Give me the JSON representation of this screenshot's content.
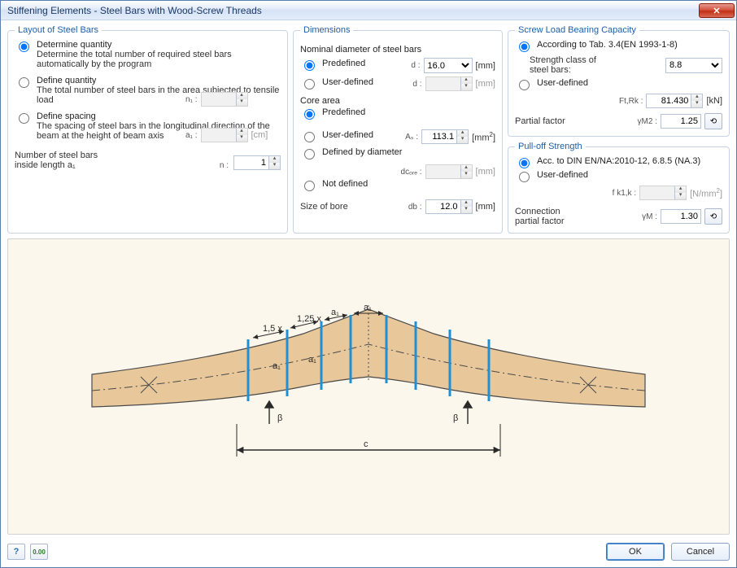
{
  "window": {
    "title": "Stiffening Elements - Steel Bars with Wood-Screw Threads"
  },
  "layout": {
    "legend": "Layout of Steel Bars",
    "opt_determine_title": "Determine quantity",
    "opt_determine_desc": "Determine the total number of required steel bars automatically by the program",
    "opt_define_qty_title": "Define quantity",
    "opt_define_qty_desc": "The total number of steel bars in the area subjected to tensile load",
    "n1_sym": "n₁ :",
    "n1_value": "",
    "opt_define_spacing_title": "Define spacing",
    "opt_define_spacing_desc": "The spacing of steel bars in the longitudinal direction of the beam at the height of beam axis",
    "a1_sym": "a₁ :",
    "a1_value": "",
    "a1_unit": "[cm]",
    "num_bars_label_l1": "Number of steel bars",
    "num_bars_label_l2": "inside length a₁",
    "n_sym": "n :",
    "n_value": "1"
  },
  "dimensions": {
    "legend": "Dimensions",
    "nominal_label": "Nominal diameter of steel bars",
    "predef": "Predefined",
    "userdef": "User-defined",
    "d_sym": "d :",
    "d_value": "16.0",
    "d_unit": "[mm]",
    "d_user_value": "",
    "core_label": "Core area",
    "As_sym": "Aₛ :",
    "As_value": "113.1",
    "As_unit": "[mm",
    "def_by_diam": "Defined by diameter",
    "dcore_sym": "dcₒᵣₑ :",
    "dcore_value": "",
    "dcore_unit": "[mm]",
    "not_defined": "Not defined",
    "size_bore_label": "Size of bore",
    "db_sym": "db :",
    "db_value": "12.0",
    "db_unit": "[mm]"
  },
  "screw": {
    "legend": "Screw Load Bearing Capacity",
    "opt_tab": "According to Tab. 3.4(EN 1993-1-8)",
    "strength_label_l1": "Strength class of",
    "strength_label_l2": "steel bars:",
    "strength_value": "8.8",
    "opt_user": "User-defined",
    "FtRk_sym": "Ft,Rk :",
    "FtRk_value": "81.430",
    "FtRk_unit": "[kN]",
    "partial_label": "Partial factor",
    "gM2_sym": "γM2 :",
    "gM2_value": "1.25"
  },
  "pulloff": {
    "legend": "Pull-off Strength",
    "opt_din": "Acc. to DIN EN/NA:2010-12, 6.8.5 (NA.3)",
    "opt_user": "User-defined",
    "fk1_sym": "f k1,k :",
    "fk1_value": "",
    "fk1_unit": "[N/mm",
    "conn_label_l1": "Connection",
    "conn_label_l2": "partial factor",
    "gM_sym": "γM :",
    "gM_value": "1.30"
  },
  "diagram": {
    "label_15x": "1,5 x",
    "label_125x": "1,25 x",
    "a1": "a₁",
    "beta": "β",
    "c": "c"
  },
  "footer": {
    "ok": "OK",
    "cancel": "Cancel"
  }
}
